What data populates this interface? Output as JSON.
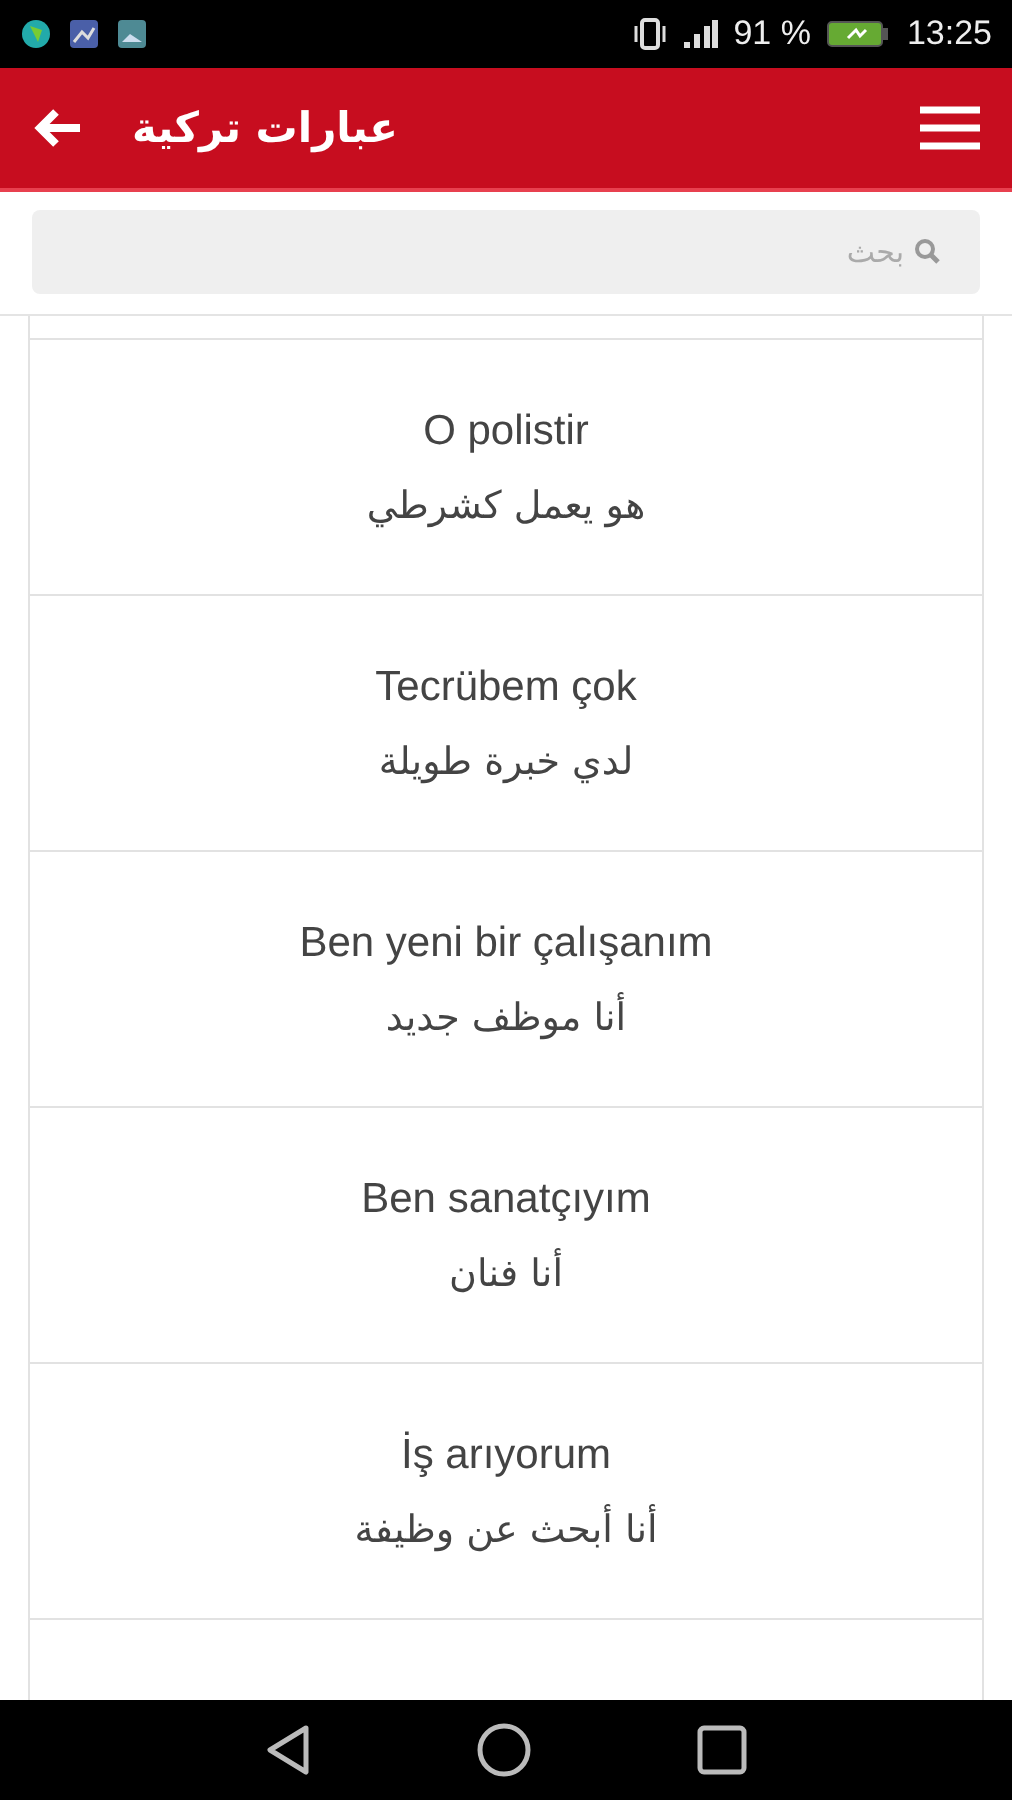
{
  "status_bar": {
    "battery_text": "91 %",
    "time": "13:25"
  },
  "app_bar": {
    "title": "عبارات تركية"
  },
  "search": {
    "placeholder": "بحث"
  },
  "phrases": [
    {
      "turkish": "O polistir",
      "arabic": "هو يعمل كشرطي"
    },
    {
      "turkish": "Tecrübem çok",
      "arabic": "لدي خبرة طويلة"
    },
    {
      "turkish": "Ben yeni bir çalışanım",
      "arabic": "أنا موظف جديد"
    },
    {
      "turkish": "Ben sanatçıyım",
      "arabic": "أنا فنان"
    },
    {
      "turkish": "İş arıyorum",
      "arabic": "أنا أبحث عن وظيفة"
    }
  ]
}
